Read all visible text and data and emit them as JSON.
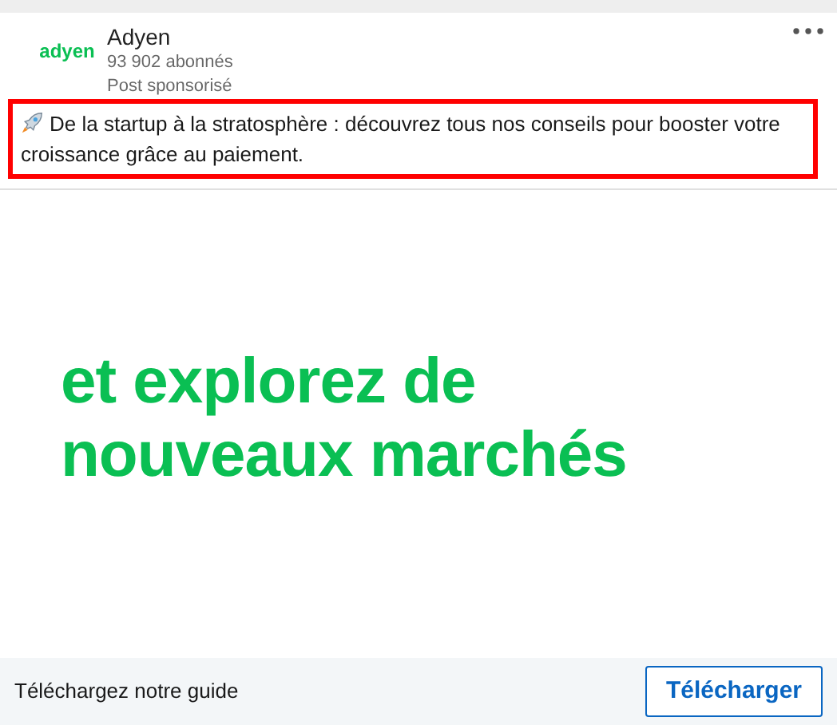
{
  "post": {
    "logo": "adyen",
    "author": "Adyen",
    "followers": "93 902 abonnés",
    "label": "Post sponsorisé",
    "text": "De la startup à la stratosphère : découvrez tous nos conseils pour booster votre croissance grâce au paiement.",
    "highlighted": true
  },
  "creative": {
    "headline": [
      "et explorez de",
      "nouveaux marchés"
    ]
  },
  "footer": {
    "caption": "Téléchargez notre guide",
    "button": "Télécharger"
  }
}
